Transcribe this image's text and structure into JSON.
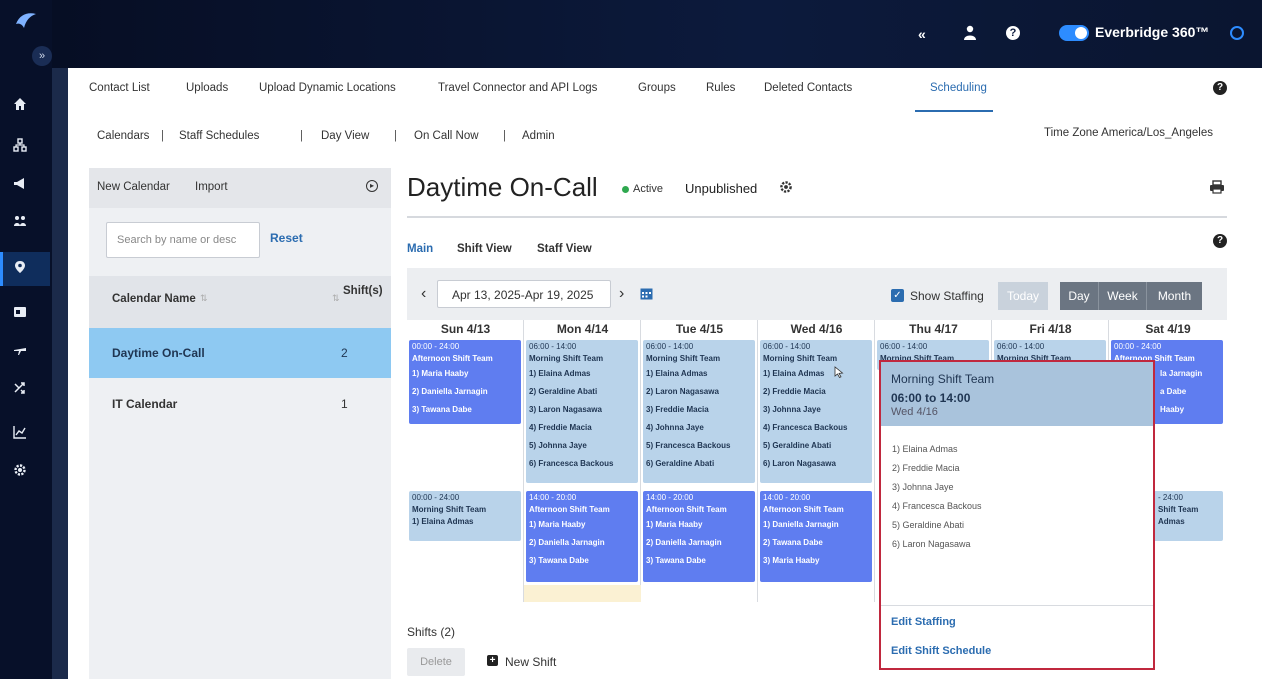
{
  "header": {
    "collapse_glyph": "«",
    "brand_name": "Everbridge 360™",
    "icons": [
      "collapse-icon",
      "user-icon",
      "help-icon",
      "toggle-switch",
      "settings-ring-icon"
    ]
  },
  "sidebar": {
    "expand_glyph": "»",
    "items": [
      "home-icon",
      "org-icon",
      "megaphone-icon",
      "people-icon",
      "location-icon",
      "id-card-icon",
      "travel-icon",
      "crossed-arrows-icon",
      "analytics-icon",
      "gear-icon"
    ],
    "active_item": "location-icon"
  },
  "nav": {
    "tabs": [
      "Contact List",
      "Uploads",
      "Upload Dynamic Locations",
      "Travel Connector and API Logs",
      "Groups",
      "Rules",
      "Deleted Contacts",
      "Scheduling"
    ],
    "active_tab": "Scheduling"
  },
  "subnav": {
    "tabs": [
      "Calendars",
      "Staff Schedules",
      "Day View",
      "On Call Now",
      "Admin"
    ],
    "separator": "|",
    "timezone": "Time Zone America/Los_Angeles"
  },
  "left_panel": {
    "new_calendar": "New Calendar",
    "import": "Import",
    "search_placeholder": "Search by name or desc",
    "reset": "Reset",
    "col_name": "Calendar Name",
    "col_shifts": "Shift(s)",
    "rows": [
      {
        "name": "Daytime On-Call",
        "shifts": "2"
      },
      {
        "name": "IT Calendar",
        "shifts": "1"
      }
    ]
  },
  "calendar": {
    "title": "Daytime On-Call",
    "status": "Active",
    "publish_state": "Unpublished",
    "view_tabs": [
      "Main",
      "Shift View",
      "Staff View"
    ],
    "date_range": "Apr 13, 2025-Apr 19, 2025",
    "show_staffing": "Show Staffing",
    "today": "Today",
    "day": "Day",
    "week": "Week",
    "month": "Month",
    "days": [
      "Sun 4/13",
      "Mon 4/14",
      "Tue 4/15",
      "Wed 4/16",
      "Thu 4/17",
      "Fri 4/18",
      "Sat 4/19"
    ],
    "shifts_label": "Shifts (2)",
    "delete": "Delete",
    "new_shift": "New Shift",
    "colors": {
      "light_shift": "#b9d3ea",
      "dark_shift": "#5f7df0",
      "selected_row": "#8ec9f2",
      "accent": "#2b6cb0",
      "popup_border": "#c0283e"
    }
  },
  "blocks": {
    "sun_top": {
      "time": "00:00 - 24:00",
      "team": "Afternoon Shift Team",
      "names": [
        "1) Maria Haaby",
        "2) Daniella Jarnagin",
        "3) Tawana Dabe"
      ]
    },
    "sun_bottom": {
      "time": "00:00 - 24:00",
      "team": "Morning Shift Team",
      "names": [
        "1) Elaina Admas"
      ]
    },
    "mon_top": {
      "time": "06:00 - 14:00",
      "team": "Morning Shift Team",
      "names": [
        "1) Elaina Admas",
        "2) Geraldine Abati",
        "3) Laron Nagasawa",
        "4) Freddie Macia",
        "5) Johnna Jaye",
        "6) Francesca Backous"
      ]
    },
    "mon_bottom": {
      "time": "14:00 - 20:00",
      "team": "Afternoon Shift Team",
      "names": [
        "1) Maria Haaby",
        "2) Daniella Jarnagin",
        "3) Tawana Dabe"
      ]
    },
    "tue_top": {
      "time": "06:00 - 14:00",
      "team": "Morning Shift Team",
      "names": [
        "1) Elaina Admas",
        "2) Laron Nagasawa",
        "3) Freddie Macia",
        "4) Johnna Jaye",
        "5) Francesca Backous",
        "6) Geraldine Abati"
      ]
    },
    "tue_bottom": {
      "time": "14:00 - 20:00",
      "team": "Afternoon Shift Team",
      "names": [
        "1) Maria Haaby",
        "2) Daniella Jarnagin",
        "3) Tawana Dabe"
      ]
    },
    "wed_top": {
      "time": "06:00 - 14:00",
      "team": "Morning Shift Team",
      "names": [
        "1) Elaina Admas",
        "2) Freddie Macia",
        "3) Johnna Jaye",
        "4) Francesca Backous",
        "5) Geraldine Abati",
        "6) Laron Nagasawa"
      ]
    },
    "wed_bottom": {
      "time": "14:00 - 20:00",
      "team": "Afternoon Shift Team",
      "names": [
        "1) Daniella Jarnagin",
        "2) Tawana Dabe",
        "3) Maria Haaby"
      ]
    },
    "thu_top": {
      "time": "06:00 - 14:00",
      "team": "Morning Shift Team"
    },
    "fri_top": {
      "time": "06:00 - 14:00",
      "team": "Morning Shift Team"
    },
    "sat_top": {
      "time": "00:00 - 24:00",
      "team": "Afternoon Shift Team",
      "names": [
        "la Jarnagin",
        "a Dabe",
        "Haaby"
      ]
    },
    "sat_bottom": {
      "time": "- 24:00",
      "team": "Shift Team",
      "names": [
        "Admas"
      ]
    }
  },
  "popup": {
    "team": "Morning Shift Team",
    "time": "06:00 to 14:00",
    "date": "Wed 4/16",
    "names": [
      "1) Elaina Admas",
      "2) Freddie Macia",
      "3) Johnna Jaye",
      "4) Francesca Backous",
      "5) Geraldine Abati",
      "6) Laron Nagasawa"
    ],
    "edit_staffing": "Edit Staffing",
    "edit_schedule": "Edit Shift Schedule"
  }
}
